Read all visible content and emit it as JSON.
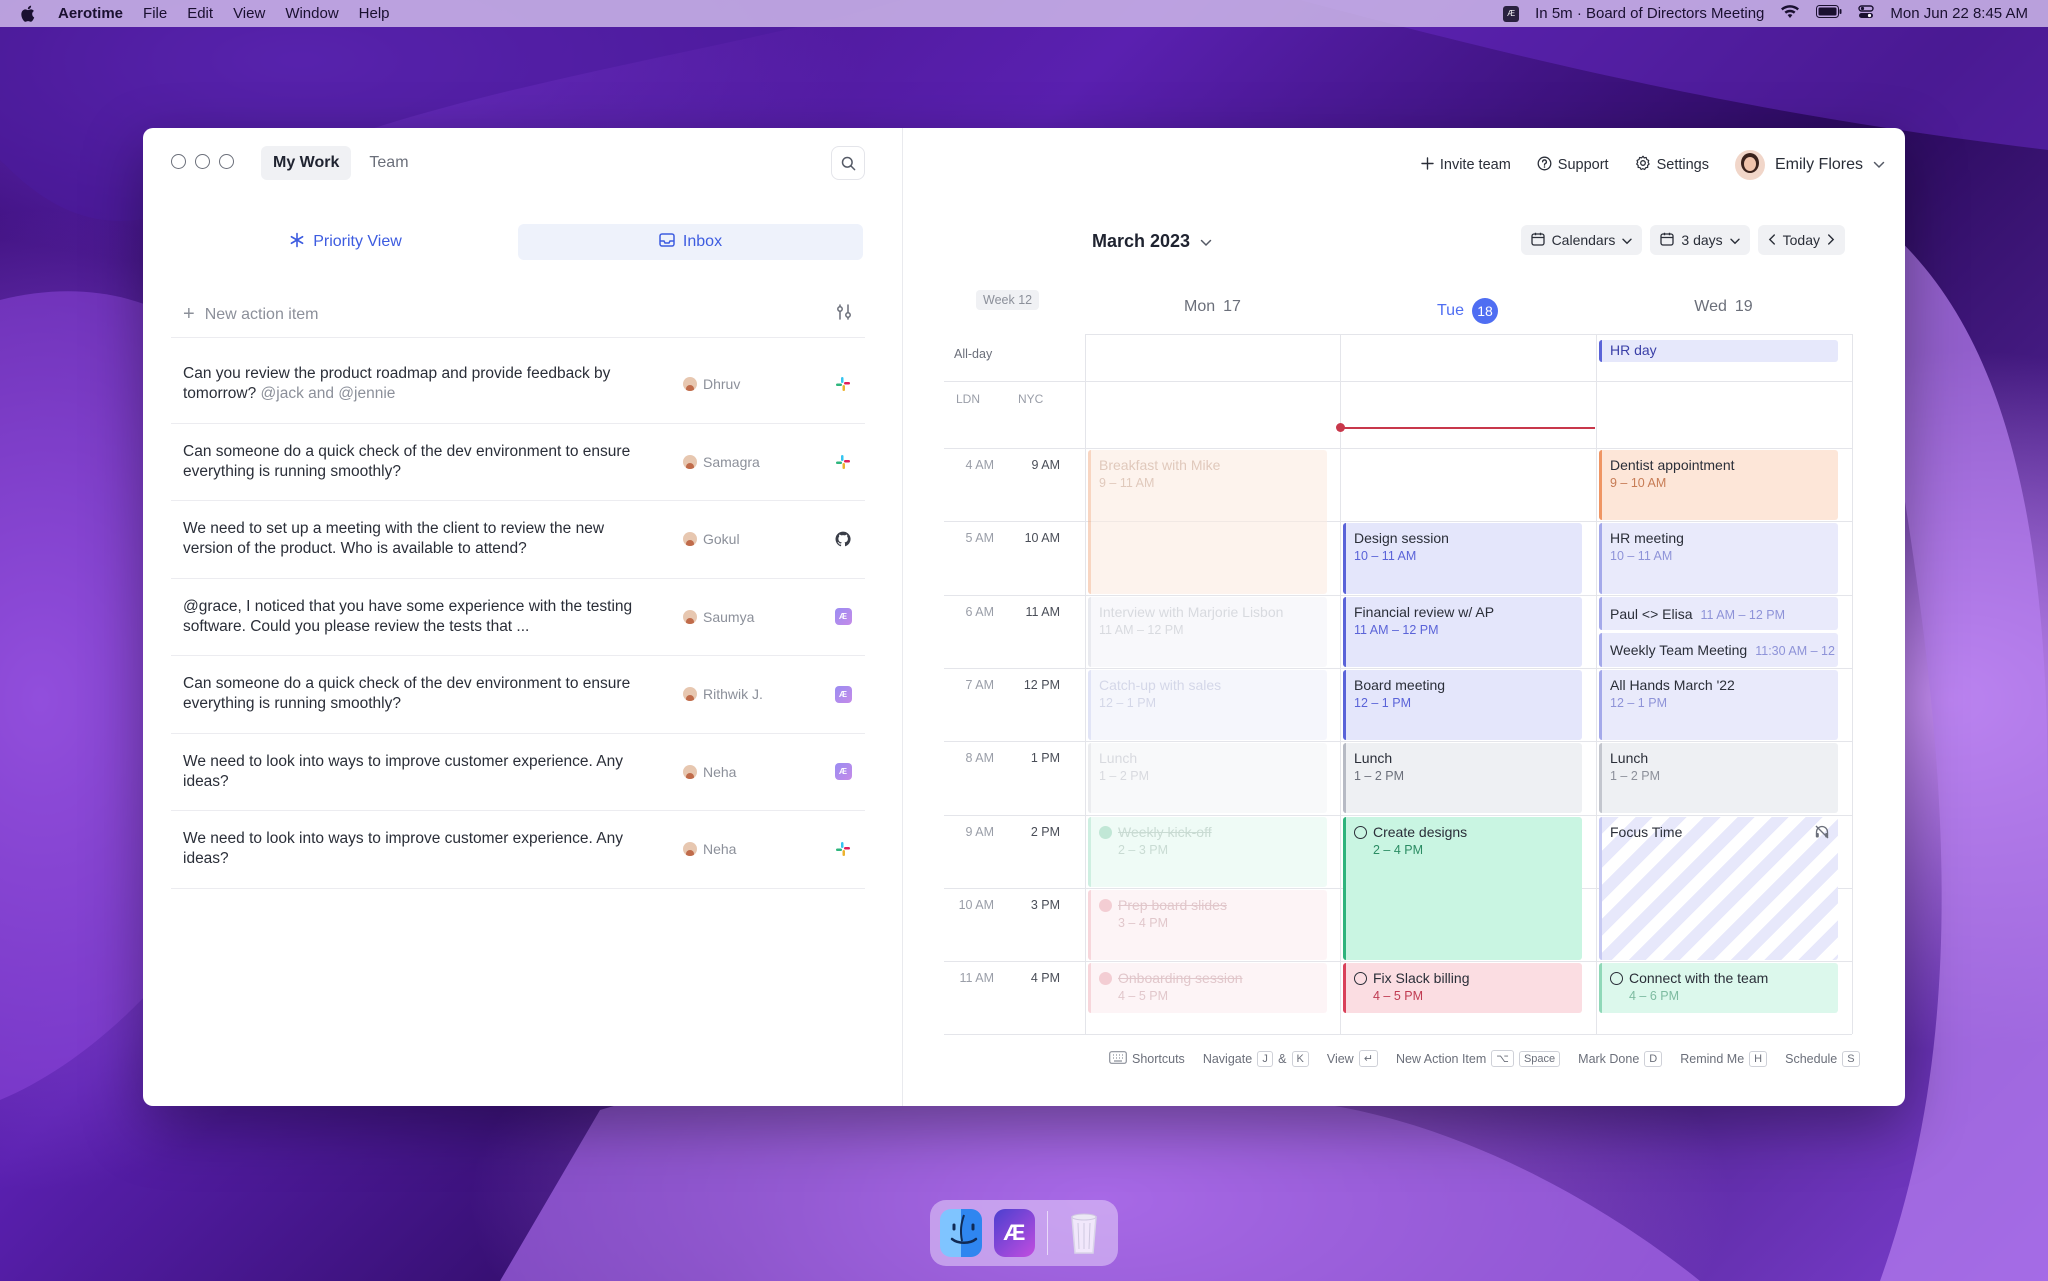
{
  "menubar": {
    "app": "Aerotime",
    "items": [
      "File",
      "Edit",
      "View",
      "Window",
      "Help"
    ],
    "next_event": "In 5m · Board of Directors Meeting",
    "datetime": "Mon Jun 22  8:45 AM"
  },
  "left": {
    "tabs": [
      "My Work",
      "Team"
    ],
    "views": {
      "priority": "Priority View",
      "inbox": "Inbox"
    },
    "new_action_placeholder": "New action item",
    "items": [
      {
        "text": "Can you review the product roadmap and provide feedback by tomorrow?",
        "mention": "@jack and @jennie",
        "who": "Dhruv",
        "source": "slack-icon"
      },
      {
        "text": "Can someone do a quick check of the dev environment to ensure everything is running smoothly?",
        "mention": "",
        "who": "Samagra",
        "source": "slack-icon"
      },
      {
        "text": "We need to set up a meeting with the client to review the new version of the product. Who is available to attend?",
        "mention": "",
        "who": "Gokul",
        "source": "github-icon"
      },
      {
        "text": "@grace, I noticed that you have some experience with the testing software. Could you please review the tests that ...",
        "mention": "",
        "who": "Saumya",
        "source": "aerotime-icon"
      },
      {
        "text": "Can someone do a quick check of the dev environment to ensure everything is running smoothly?",
        "mention": "",
        "who": "Rithwik J.",
        "source": "aerotime-icon"
      },
      {
        "text": "We need to look into ways to improve customer experience. Any ideas?",
        "mention": "",
        "who": "Neha",
        "source": "aerotime-icon"
      },
      {
        "text": "We need to look into ways to improve customer experience. Any ideas?",
        "mention": "",
        "who": "Neha",
        "source": "slack-icon"
      }
    ]
  },
  "right": {
    "actions": {
      "invite": "Invite team",
      "support": "Support",
      "settings": "Settings"
    },
    "user": "Emily Flores",
    "month": "March 2023",
    "controls": {
      "calendars": "Calendars",
      "days": "3 days",
      "today": "Today"
    },
    "week": "Week 12",
    "days": [
      {
        "label": "Mon",
        "num": "17",
        "today": false
      },
      {
        "label": "Tue",
        "num": "18",
        "today": true
      },
      {
        "label": "Wed",
        "num": "19",
        "today": false
      }
    ],
    "allday_label": "All-day",
    "tz": [
      "LDN",
      "NYC"
    ],
    "times_ldn": [
      "4 AM",
      "5 AM",
      "6 AM",
      "7 AM",
      "8 AM",
      "9 AM",
      "10 AM",
      "11 AM"
    ],
    "times_nyc": [
      "9 AM",
      "10 AM",
      "11 AM",
      "12 PM",
      "1 PM",
      "2 PM",
      "3 PM",
      "4 PM"
    ],
    "allday_events": [
      {
        "day": 2,
        "title": "HR day"
      }
    ],
    "events": [
      {
        "day": 0,
        "start": 0,
        "dur": 2,
        "title": "Breakfast with Mike",
        "sub": "9 – 11 AM",
        "bg": "#fdebe0",
        "bar": "#f4b48f",
        "tc": "#c89d86",
        "faded": true
      },
      {
        "day": 0,
        "start": 2,
        "dur": 1,
        "title": "Interview with Marjorie Lisbon",
        "sub": "11 AM – 12 PM",
        "bg": "#f3f4f8",
        "bar": "#d8dae3",
        "tc": "#b9bcc6",
        "faded": true
      },
      {
        "day": 0,
        "start": 3,
        "dur": 1,
        "title": "Catch-up with sales",
        "sub": "12 – 1 PM",
        "bg": "#eef0fb",
        "bar": "#c9cff0",
        "tc": "#b2b7d6",
        "faded": true
      },
      {
        "day": 0,
        "start": 4,
        "dur": 1,
        "title": "Lunch",
        "sub": "1 – 2 PM",
        "bg": "#f4f5f7",
        "bar": "#dcdee3",
        "tc": "#b9bcc6",
        "faded": true
      },
      {
        "day": 0,
        "start": 5,
        "dur": 1,
        "title": "Weekly kick-off",
        "sub": "2 – 3 PM",
        "bg": "#e3f8ef",
        "bar": "#a7e3c9",
        "tc": "#9dbfb0",
        "faded": true,
        "done": true,
        "chk": "#8fd4b5"
      },
      {
        "day": 0,
        "start": 6,
        "dur": 1,
        "title": "Prep board slides",
        "sub": "3 – 4 PM",
        "bg": "#fdecef",
        "bar": "#f2b6bf",
        "tc": "#c99aa2",
        "faded": true,
        "done": true,
        "chk": "#eaa5b0"
      },
      {
        "day": 0,
        "start": 7,
        "dur": 1,
        "title": "Onboarding session",
        "sub": "4 – 5 PM",
        "bg": "#fdecef",
        "bar": "#f2b6bf",
        "tc": "#c99aa2",
        "faded": true,
        "done": true,
        "chk": "#eaa5b0"
      },
      {
        "day": 1,
        "start": 1,
        "dur": 1,
        "title": "Design session",
        "sub": "10 – 11 AM",
        "bg": "#e4e6fb",
        "bar": "#5a63d8",
        "tc": "#5a63d8"
      },
      {
        "day": 1,
        "start": 2,
        "dur": 1,
        "title": "Financial review w/ AP",
        "sub": "11 AM – 12 PM",
        "bg": "#e4e6fb",
        "bar": "#5a63d8",
        "tc": "#5a63d8"
      },
      {
        "day": 1,
        "start": 3,
        "dur": 1,
        "title": "Board meeting",
        "sub": "12 – 1 PM",
        "bg": "#e4e6fb",
        "bar": "#5a63d8",
        "tc": "#5a63d8"
      },
      {
        "day": 1,
        "start": 4,
        "dur": 1,
        "title": "Lunch",
        "sub": "1 – 2 PM",
        "bg": "#eef0f3",
        "bar": "#b6bac4",
        "tc": "#6b6f7a"
      },
      {
        "day": 1,
        "start": 5,
        "dur": 2,
        "title": "Create designs",
        "sub": "2 – 4 PM",
        "bg": "#c9f5e2",
        "bar": "#2fb37c",
        "tc": "#2b8c63",
        "chk": "ring"
      },
      {
        "day": 1,
        "start": 7,
        "dur": 1,
        "title": "Fix Slack billing",
        "sub": "4 – 5 PM",
        "bg": "#fbdde2",
        "bar": "#d9415a",
        "tc": "#c03b52",
        "chk": "ring"
      },
      {
        "day": 2,
        "start": 0,
        "dur": 1,
        "title": "Dentist appointment",
        "sub": "9 – 10 AM",
        "bg": "#fde6d8",
        "bar": "#ef9563",
        "tc": "#c77c55"
      },
      {
        "day": 2,
        "start": 1,
        "dur": 1,
        "title": "HR meeting",
        "sub": "10 – 11 AM",
        "bg": "#e9eafb",
        "bar": "#a4a9ea",
        "tc": "#8e93d8"
      },
      {
        "day": 2,
        "start": 2,
        "dur": 0.5,
        "title": "Paul <> Elisa",
        "sub": "11 AM – 12 PM",
        "inline": true,
        "bg": "#e9eafb",
        "bar": "#a4a9ea",
        "tc": "#8e93d8"
      },
      {
        "day": 2,
        "start": 2.5,
        "dur": 0.5,
        "title": "Weekly Team Meeting",
        "sub": "11:30 AM – 12",
        "inline": true,
        "bg": "#e9eafb",
        "bar": "#a4a9ea",
        "tc": "#8e93d8"
      },
      {
        "day": 2,
        "start": 3,
        "dur": 1,
        "title": "All Hands March '22",
        "sub": "12 – 1 PM",
        "bg": "#e9eafb",
        "bar": "#a4a9ea",
        "tc": "#8e93d8"
      },
      {
        "day": 2,
        "start": 4,
        "dur": 1,
        "title": "Lunch",
        "sub": "1 – 2 PM",
        "bg": "#eef0f3",
        "bar": "#c3c6ce",
        "tc": "#8c909a"
      },
      {
        "day": 2,
        "start": 5,
        "dur": 2,
        "title": "Focus Time",
        "sub": "",
        "bg": "focus",
        "bar": "#c6c9f2",
        "tc": "#6b6f7a"
      },
      {
        "day": 2,
        "start": 7,
        "dur": 1,
        "title": "Connect with the team",
        "sub": "4 – 6 PM",
        "bg": "#dcf8ec",
        "bar": "#8fd8b8",
        "tc": "#7dbba0",
        "chk": "ring"
      }
    ],
    "shortcuts": [
      {
        "label": "Shortcuts",
        "keys": []
      },
      {
        "label": "Navigate",
        "keys": [
          "J",
          "&",
          "K"
        ]
      },
      {
        "label": "View",
        "keys": [
          "↵"
        ]
      },
      {
        "label": "New Action Item",
        "keys": [
          "⌥",
          "Space"
        ]
      },
      {
        "label": "Mark Done",
        "keys": [
          "D"
        ]
      },
      {
        "label": "Remind Me",
        "keys": [
          "H"
        ]
      },
      {
        "label": "Schedule",
        "keys": [
          "S"
        ]
      }
    ]
  }
}
